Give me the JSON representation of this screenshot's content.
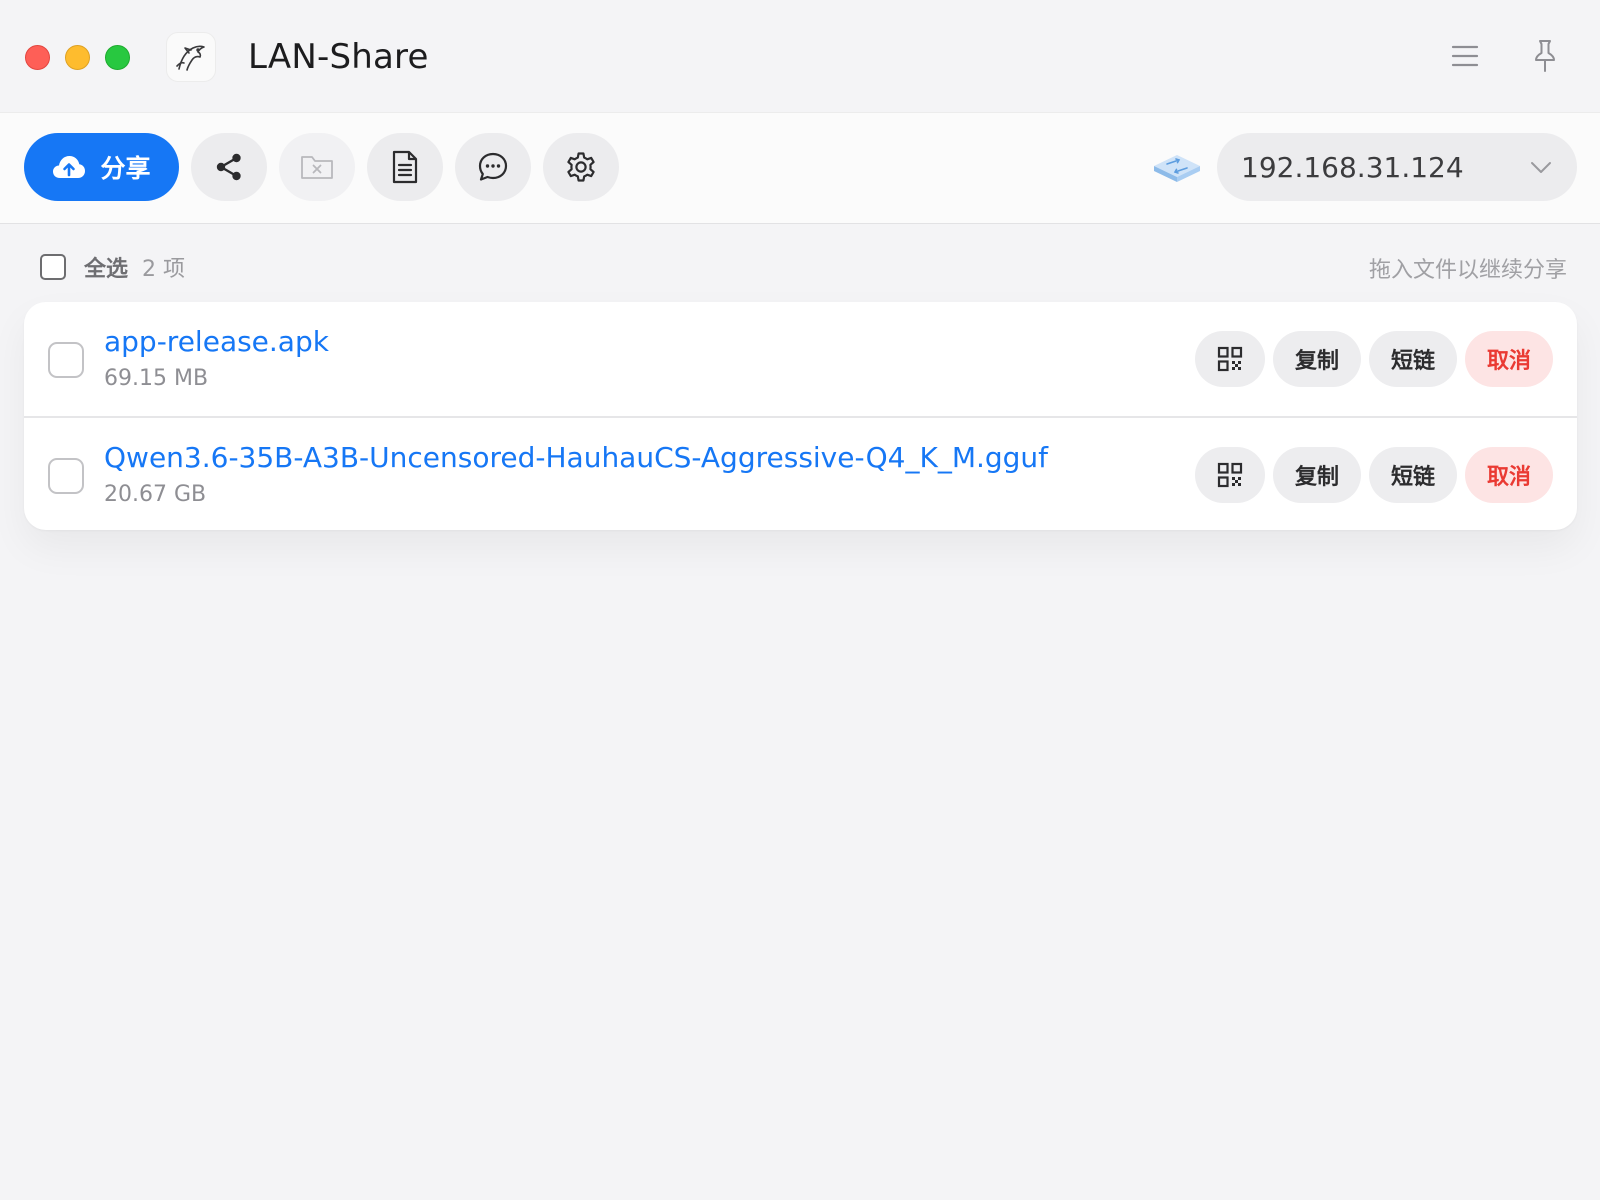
{
  "app": {
    "title": "LAN-Share"
  },
  "toolbar": {
    "share_label": "分享",
    "ip_address": "192.168.31.124",
    "icons": [
      "cloud-upload-icon",
      "share-icon",
      "folder-remove-icon",
      "document-icon",
      "chat-icon",
      "gear-icon",
      "network-icon",
      "chevron-down-icon"
    ],
    "accent_color": "#1677f5"
  },
  "selection": {
    "select_all_label": "全选",
    "count_label": "2 项",
    "drop_hint": "拖入文件以继续分享"
  },
  "files": [
    {
      "name": "app-release.apk",
      "size": "69.15 MB"
    },
    {
      "name": "Qwen3.6-35B-A3B-Uncensored-HauhauCS-Aggressive-Q4_K_M.gguf",
      "size": "20.67 GB"
    }
  ],
  "row_actions": {
    "copy_label": "复制",
    "short_link_label": "短链",
    "cancel_label": "取消",
    "cancel_color": "#ea3a33"
  }
}
